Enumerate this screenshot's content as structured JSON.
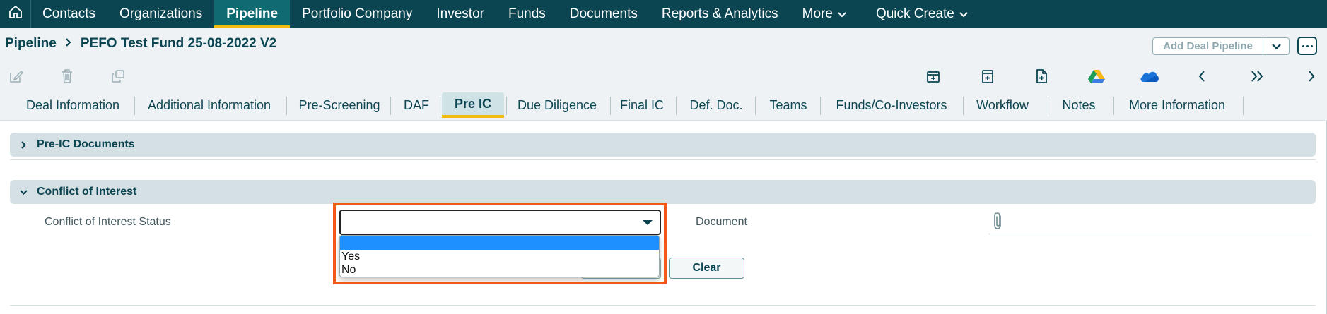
{
  "topnav": {
    "items": [
      "Contacts",
      "Organizations",
      "Pipeline",
      "Portfolio Company",
      "Investor",
      "Funds",
      "Documents",
      "Reports & Analytics",
      "More",
      "Quick Create"
    ],
    "active": "Pipeline"
  },
  "breadcrumb": {
    "root": "Pipeline",
    "current": "PEFO Test Fund 25-08-2022 V2"
  },
  "actions": {
    "add_deal_pipeline": "Add Deal Pipeline"
  },
  "toolbar": {
    "left_icons": [
      "edit-icon",
      "delete-icon",
      "copy-icon"
    ],
    "right_icons": [
      "calendar-icon",
      "add-note-icon",
      "add-document-icon",
      "google-drive-icon",
      "onedrive-icon",
      "chevron-left-icon",
      "double-chevron-right-icon",
      "chevron-right-icon"
    ]
  },
  "tabs": {
    "items": [
      "Deal Information",
      "Additional Information",
      "Pre-Screening",
      "DAF",
      "Pre IC",
      "Due Diligence",
      "Final IC",
      "Def. Doc.",
      "Teams",
      "Funds/Co-Investors",
      "Workflow",
      "Notes",
      "More Information"
    ],
    "active": "Pre IC"
  },
  "sections": {
    "pre_ic_documents": "Pre-IC Documents",
    "conflict_of_interest": "Conflict of Interest"
  },
  "form": {
    "status_label": "Conflict of Interest Status",
    "status_value": "",
    "options": [
      "",
      "Yes",
      "No"
    ],
    "document_label": "Document",
    "clear_button": "Clear"
  },
  "colors": {
    "nav_bg": "#0b4552",
    "accent": "#f2b90f",
    "highlight": "#f05a14",
    "option_selected": "#1e90ff"
  }
}
